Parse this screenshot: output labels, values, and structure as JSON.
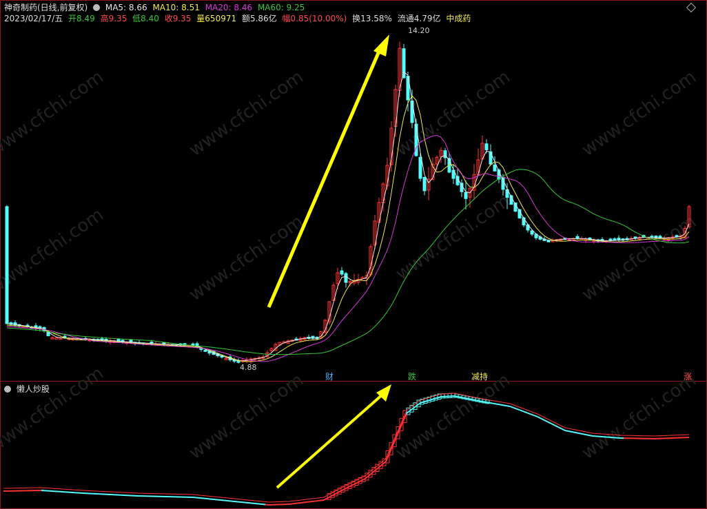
{
  "header": {
    "title": "神奇制药(日线,前复权)",
    "ma5": {
      "label": "MA5: 8.66",
      "color": "#e6e6e6"
    },
    "ma10": {
      "label": "MA10: 8.51",
      "color": "#f2ea4a"
    },
    "ma20": {
      "label": "MA20: 8.46",
      "color": "#d936d9"
    },
    "ma60": {
      "label": "MA60: 9.25",
      "color": "#36c936"
    },
    "date": "2023/02/17/五",
    "open": "开8.49",
    "high": "高9.35",
    "low": "低8.40",
    "close": "收9.35",
    "volume": "量650971",
    "amount": "额5.86亿",
    "change": "幅0.85(10.00%)",
    "turnover": "换13.58%",
    "float": "流通4.79亿",
    "sector": "中成药"
  },
  "indicator": {
    "name": "懒人炒股"
  },
  "watermark": "www.cfchi.com",
  "tags": {
    "cai": "财",
    "die": "跌",
    "jianchi": "减持",
    "zhang": "涨"
  },
  "colors": {
    "up": "#ff3232",
    "down": "#54fcfc",
    "arrow": "#ffff00"
  },
  "chart_data": [
    {
      "type": "candlestick",
      "annotations": {
        "high_label": "14.20",
        "low_label": "4.88"
      },
      "series": [
        {
          "name": "MA5",
          "color": "#e6e6e6"
        },
        {
          "name": "MA10",
          "color": "#f2ea4a"
        },
        {
          "name": "MA20",
          "color": "#d936d9"
        },
        {
          "name": "MA60",
          "color": "#36c936"
        }
      ]
    },
    {
      "type": "line",
      "series": [
        {
          "name": "懒人炒股"
        }
      ]
    }
  ]
}
